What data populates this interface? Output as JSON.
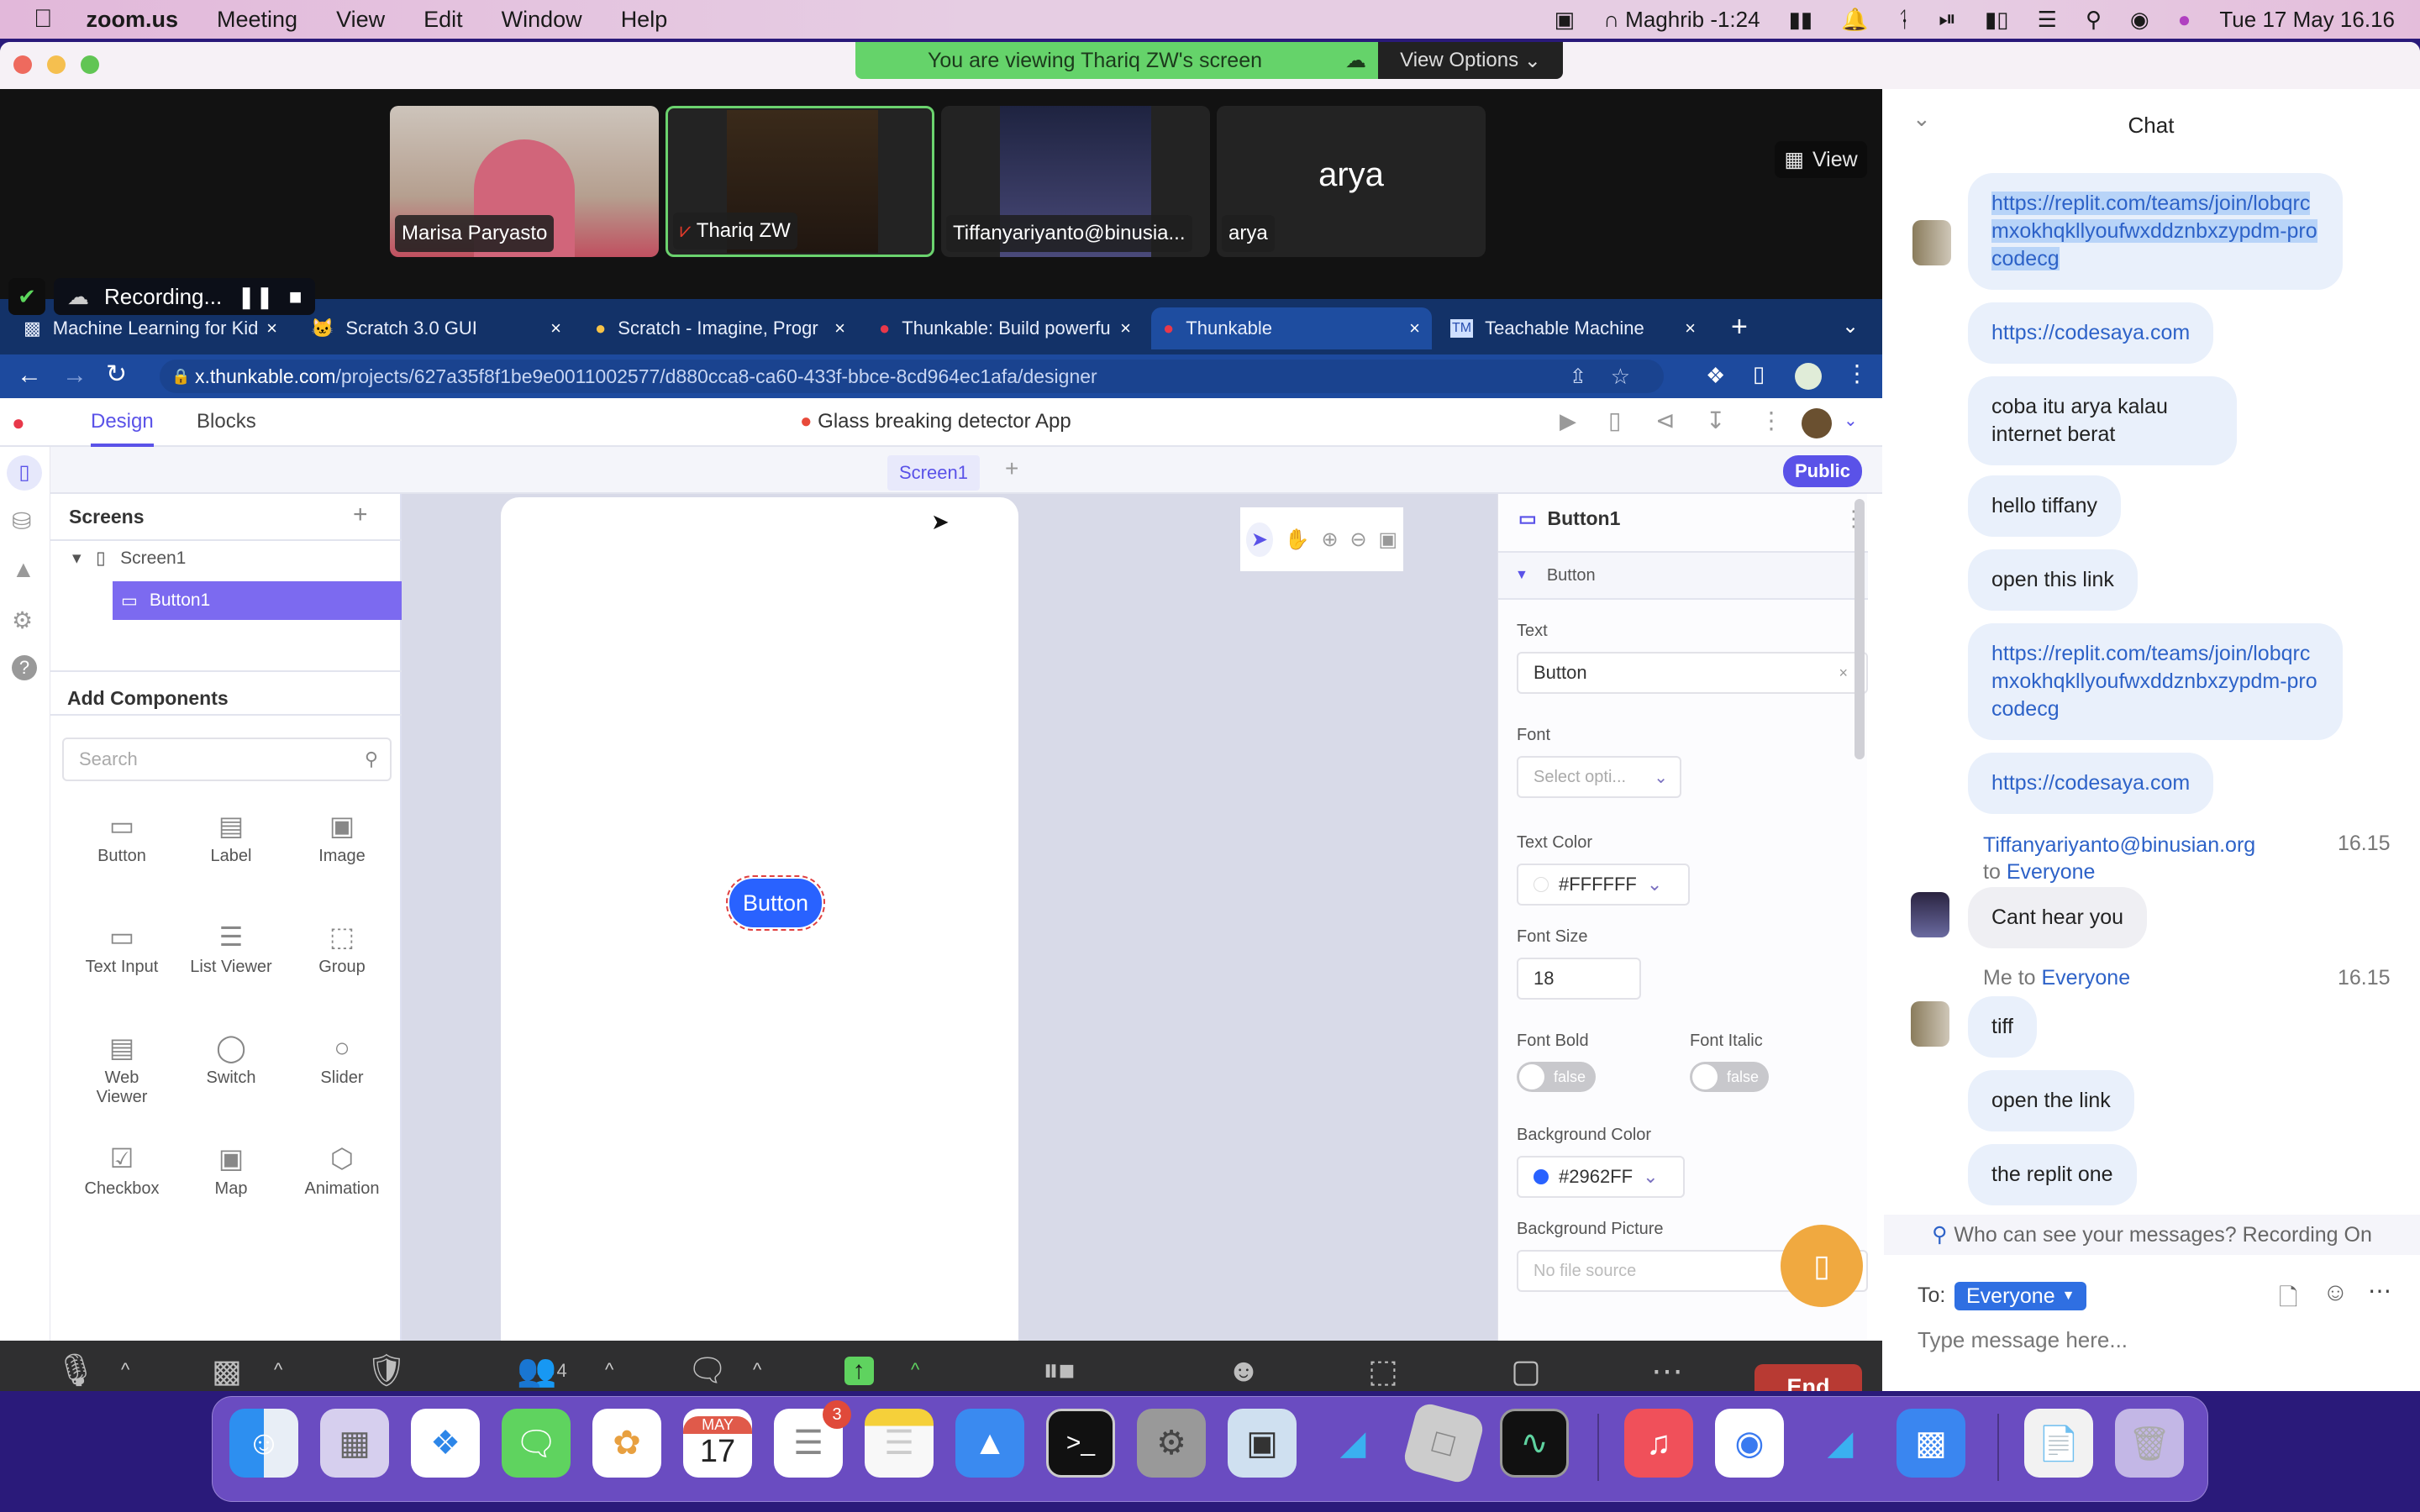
{
  "menubar": {
    "apple": "",
    "app_name": "zoom.us",
    "menus": [
      "Meeting",
      "View",
      "Edit",
      "Window",
      "Help"
    ],
    "status": {
      "prayer": "Maghrib -1:24",
      "datetime": "Tue 17 May  16.16"
    }
  },
  "zoom": {
    "share_banner": "You are viewing Thariq ZW's screen",
    "view_options": "View Options",
    "view_button": "View",
    "participants": [
      {
        "name": "Marisa Paryasto",
        "type": "video"
      },
      {
        "name": "Thariq ZW",
        "type": "video",
        "muted": true,
        "active_speaker": true
      },
      {
        "name": "Tiffanyariyanto@binusia...",
        "type": "video"
      },
      {
        "name": "arya",
        "type": "name",
        "center_label": "arya"
      }
    ],
    "recording_label": "Recording...",
    "controls": [
      {
        "label": "Mute",
        "icon": "microphone-icon"
      },
      {
        "label": "Stop Video",
        "icon": "video-camera-icon"
      },
      {
        "label": "Security",
        "icon": "shield-icon"
      },
      {
        "label": "Participants",
        "icon": "participants-icon",
        "count": "4"
      },
      {
        "label": "Chat",
        "icon": "chat-bubble-icon"
      },
      {
        "label": "Share Screen",
        "icon": "share-screen-icon"
      },
      {
        "label": "Pause/Stop Recording",
        "icon": "pause-stop-icon"
      },
      {
        "label": "Reactions",
        "icon": "reactions-icon"
      },
      {
        "label": "Apps",
        "icon": "apps-icon"
      },
      {
        "label": "Whiteboards",
        "icon": "whiteboard-icon"
      },
      {
        "label": "More",
        "icon": "more-icon"
      }
    ],
    "end_label": "End"
  },
  "browser": {
    "tabs": [
      {
        "title": "Machine Learning for Kid",
        "active": false
      },
      {
        "title": "Scratch 3.0 GUI",
        "active": false
      },
      {
        "title": "Scratch - Imagine, Progr",
        "active": false
      },
      {
        "title": "Thunkable: Build powerfu",
        "active": false
      },
      {
        "title": "Thunkable",
        "active": true
      },
      {
        "title": "Teachable Machine",
        "active": false
      }
    ],
    "url_host": "x.thunkable.com",
    "url_path": "/projects/627a35f8f1be9e0011002577/d880cca8-ca60-433f-bbce-8cd964ec1afa/designer"
  },
  "thunkable": {
    "tabs": [
      "Design",
      "Blocks"
    ],
    "active_tab": "Design",
    "project_title": "Glass breaking detector App",
    "screen_tab": "Screen1",
    "public_badge": "Public",
    "screens_title": "Screens",
    "tree": [
      {
        "label": "Screen1"
      },
      {
        "label": "Button1",
        "selected": true
      }
    ],
    "add_components_title": "Add Components",
    "search_placeholder": "Search",
    "components": [
      {
        "label": "Button"
      },
      {
        "label": "Label"
      },
      {
        "label": "Image"
      },
      {
        "label": "Text Input"
      },
      {
        "label": "List Viewer"
      },
      {
        "label": "Group"
      },
      {
        "label": "Web Viewer"
      },
      {
        "label": "Switch"
      },
      {
        "label": "Slider"
      },
      {
        "label": "Checkbox"
      },
      {
        "label": "Map"
      },
      {
        "label": "Animation"
      }
    ],
    "canvas_button_text": "Button",
    "props": {
      "component_name": "Button1",
      "section": "Button",
      "text_label": "Text",
      "text_value": "Button",
      "font_label": "Font",
      "font_placeholder": "Select opti...",
      "text_color_label": "Text Color",
      "text_color_value": "#FFFFFF",
      "font_size_label": "Font Size",
      "font_size_value": "18",
      "font_bold_label": "Font Bold",
      "font_bold_value": "false",
      "font_italic_label": "Font Italic",
      "font_italic_value": "false",
      "bg_color_label": "Background Color",
      "bg_color_value": "#2962FF",
      "bg_picture_label": "Background Picture",
      "bg_picture_placeholder": "No file source"
    }
  },
  "chat": {
    "title": "Chat",
    "messages": [
      {
        "text": "https://replit.com/teams/join/lobqrcmxokhqkllyoufwxddznbxzypdm-procodecg",
        "link": true,
        "selected": true
      },
      {
        "text": "https://codesaya.com",
        "link": true
      },
      {
        "text": "coba itu arya kalau internet berat"
      },
      {
        "text": "hello tiffany"
      },
      {
        "text": "open this link"
      },
      {
        "text": "https://replit.com/teams/join/lobqrcmxokhqkllyoufwxddznbxzypdm-procodecg",
        "link": true
      },
      {
        "text": "https://codesaya.com",
        "link": true
      }
    ],
    "group2": {
      "sender": "Tiffanyariyanto@binusian.org",
      "to_word": "to",
      "recipient": "Everyone",
      "time": "16.15",
      "messages": [
        "Cant hear you"
      ]
    },
    "group3": {
      "sender": "Me",
      "to_word": "to",
      "recipient": "Everyone",
      "time": "16.15",
      "messages": [
        "tiff",
        "open the link",
        "the replit one"
      ]
    },
    "privacy_note": "Who can see your messages? Recording On",
    "to_label": "To:",
    "to_value": "Everyone",
    "input_placeholder": "Type message here..."
  },
  "dock": {
    "apps": [
      "Finder",
      "Launchpad",
      "Safari",
      "Messages",
      "Photos",
      "Calendar",
      "Reminders",
      "Notes",
      "Keynote",
      "Terminal",
      "System Preferences",
      "Preview",
      "Roblox Studio",
      "Roblox",
      "Activity Monitor",
      "Music",
      "Chrome",
      "Roblox Studio",
      "Zoom",
      "Downloads",
      "Trash"
    ],
    "calendar_month": "MAY",
    "calendar_day": "17",
    "reminders_badge": "3"
  }
}
